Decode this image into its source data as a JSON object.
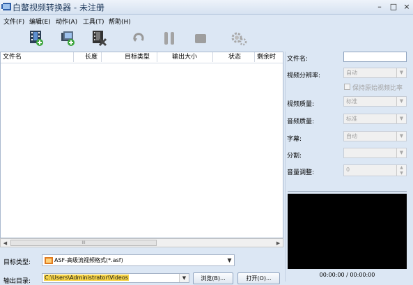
{
  "window": {
    "title": "白鳖视频转换器 - 未注册",
    "minimize": "–",
    "maximize": "□",
    "close": "×"
  },
  "menu": [
    "文件(F)",
    "编辑(E)",
    "动作(A)",
    "工具(T)",
    "帮助(H)"
  ],
  "toolbar": {
    "add_file": "add-video-icon",
    "add_folder": "add-folder-icon",
    "remove": "remove-video-icon",
    "refresh": "refresh-icon",
    "pause": "pause-icon",
    "stop": "stop-icon",
    "settings": "gear-icon"
  },
  "list": {
    "columns": [
      "文件名",
      "长度",
      "目标类型",
      "输出大小",
      "状态",
      "剩余时"
    ],
    "scroll_thumb": "III"
  },
  "bottom": {
    "target_type_label": "目标类型:",
    "target_type_value": "ASF-高级流视频格式(*.asf)",
    "output_dir_label": "输出目录:",
    "output_dir_value": "C:\\Users\\Administrator\\Videos",
    "browse_button": "浏览(B)...",
    "open_button": "打开(O)..."
  },
  "props": {
    "filename_label": "文件名:",
    "filename_value": "",
    "resolution_label": "视频分辨率:",
    "resolution_value": "自动",
    "keep_ratio_label": "保持原始视频比率",
    "video_quality_label": "视频质量:",
    "video_quality_value": "标准",
    "audio_quality_label": "音频质量:",
    "audio_quality_value": "标准",
    "subtitle_label": "字幕:",
    "subtitle_value": "自动",
    "split_label": "分割:",
    "split_value": "",
    "volume_label": "音量调整:",
    "volume_value": "0"
  },
  "preview": {
    "timecode": "00:00:00 / 00:00:00"
  },
  "colors": {
    "background": "#dce7f4",
    "highlight": "#f7d54a",
    "video_bg": "#000000"
  }
}
